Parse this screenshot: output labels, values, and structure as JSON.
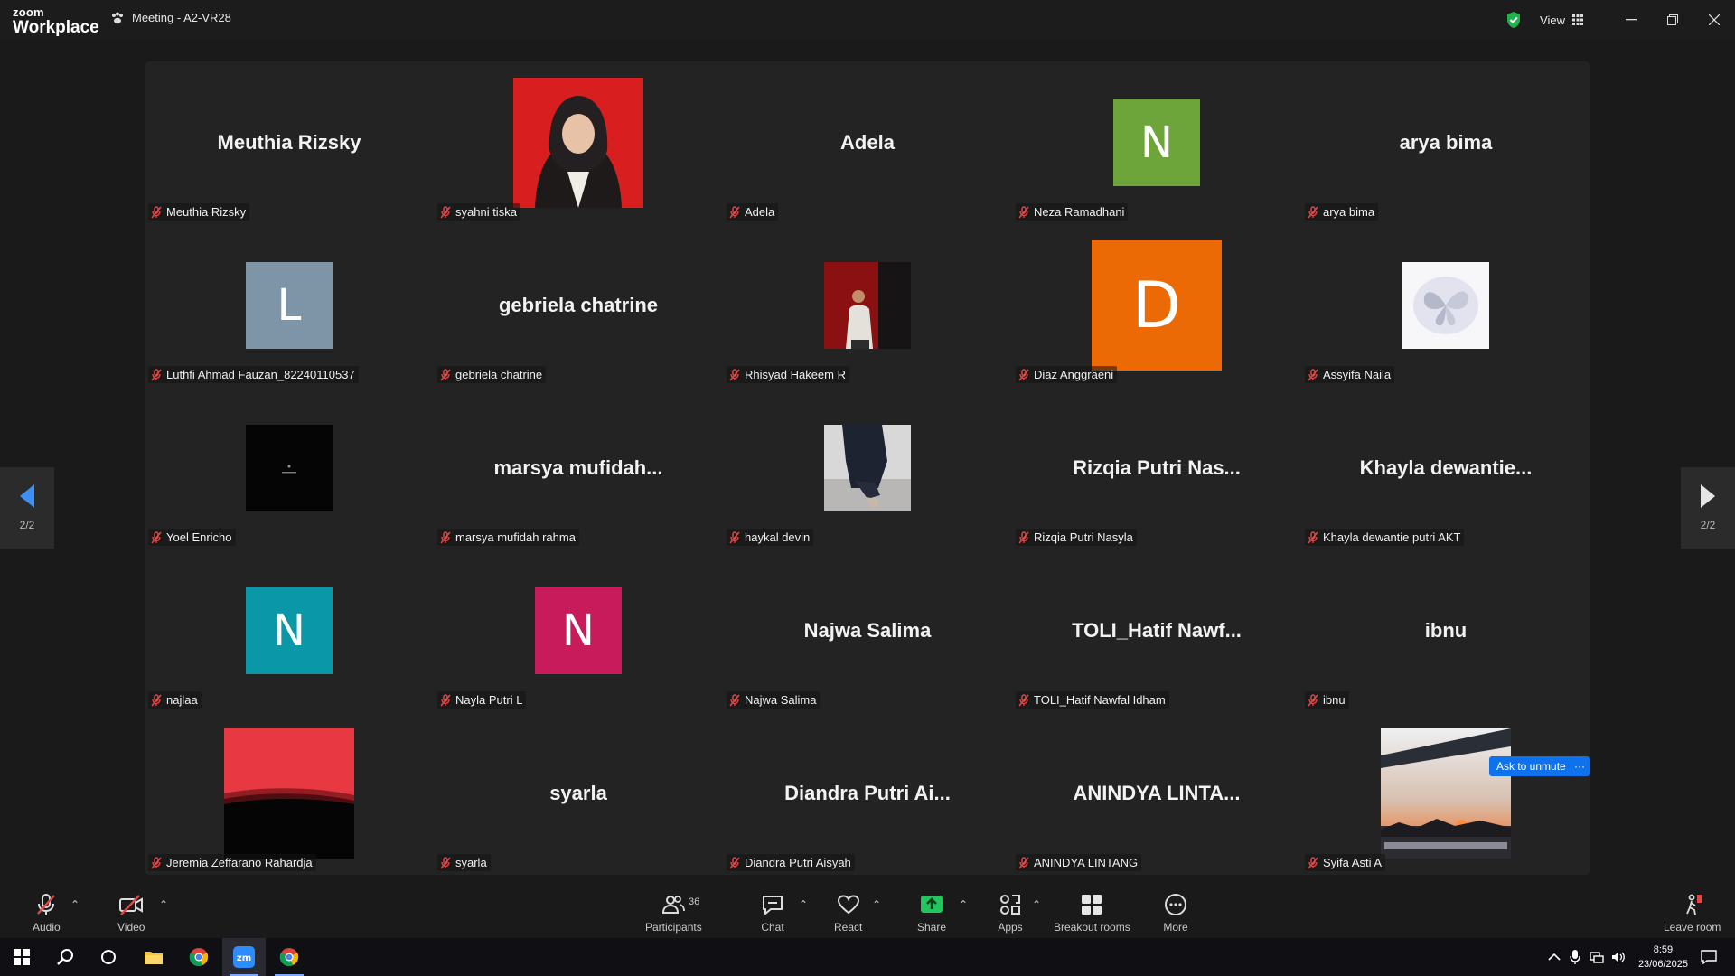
{
  "window": {
    "logo_line1": "zoom",
    "logo_line2": "Workplace",
    "meeting_title": "Meeting - A2-VR28",
    "view_label": "View"
  },
  "pager": {
    "left_label": "2/2",
    "right_label": "2/2"
  },
  "tiles": [
    {
      "name": "Meuthia Rizsky",
      "display": "Meuthia Rizsky",
      "kind": "name"
    },
    {
      "name": "syahni tiska",
      "display": "",
      "kind": "photo",
      "icon": "hijab-portrait"
    },
    {
      "name": "Adela",
      "display": "Adela",
      "kind": "name"
    },
    {
      "name": "Neza Ramadhani",
      "display": "N",
      "kind": "initial",
      "color": "#6ea53b"
    },
    {
      "name": "arya bima",
      "display": "arya bima",
      "kind": "name"
    },
    {
      "name": "Luthfi Ahmad Fauzan_82240110537",
      "display": "L",
      "kind": "initial",
      "color": "#7d95a6"
    },
    {
      "name": "gebriela chatrine",
      "display": "gebriela chatrine",
      "kind": "name"
    },
    {
      "name": "Rhisyad Hakeem R",
      "display": "",
      "kind": "photo",
      "icon": "red-room-photo"
    },
    {
      "name": "Diaz Anggraeni",
      "display": "D",
      "kind": "initial",
      "color": "#ec6a05"
    },
    {
      "name": "Assyifa Naila",
      "display": "",
      "kind": "photo",
      "icon": "butterfly-image"
    },
    {
      "name": "Yoel Enricho",
      "display": "",
      "kind": "photo",
      "icon": "dark-logo"
    },
    {
      "name": "marsya mufidah rahma",
      "display": "marsya  mufidah...",
      "kind": "name"
    },
    {
      "name": "haykal devin",
      "display": "",
      "kind": "photo",
      "icon": "person-sitting-photo"
    },
    {
      "name": "Rizqia Putri Nasyla",
      "display": "Rizqia Putri Nas...",
      "kind": "name"
    },
    {
      "name": "Khayla dewantie putri AKT",
      "display": "Khayla  dewantie...",
      "kind": "name"
    },
    {
      "name": "najlaa",
      "display": "N",
      "kind": "initial",
      "color": "#0a97a8"
    },
    {
      "name": "Nayla Putri L",
      "display": "N",
      "kind": "initial",
      "color": "#c81b5b"
    },
    {
      "name": "Najwa Salima",
      "display": "Najwa Salima",
      "kind": "name"
    },
    {
      "name": "TOLI_Hatif Nawfal Idham",
      "display": "TOLI_Hatif  Nawf...",
      "kind": "name"
    },
    {
      "name": "ibnu",
      "display": "ibnu",
      "kind": "name"
    },
    {
      "name": "Jeremia Zeffarano Rahardja",
      "display": "",
      "kind": "photo",
      "icon": "red-gradient-image"
    },
    {
      "name": "syarla",
      "display": "syarla",
      "kind": "name"
    },
    {
      "name": "Diandra Putri Aisyah",
      "display": "Diandra Putri Ai...",
      "kind": "name"
    },
    {
      "name": "ANINDYA LINTANG",
      "display": "ANINDYA  LINTA...",
      "kind": "name"
    },
    {
      "name": "Syifa Asti A",
      "display": "",
      "kind": "photo",
      "icon": "sunset-photo"
    }
  ],
  "ask_to_unmute": "Ask to unmute",
  "more_dots": "···",
  "toolbar": {
    "audio": "Audio",
    "video": "Video",
    "participants": "Participants",
    "participants_count": "36",
    "chat": "Chat",
    "react": "React",
    "share": "Share",
    "apps": "Apps",
    "breakout": "Breakout rooms",
    "more": "More",
    "leave": "Leave room"
  },
  "taskbar": {
    "time": "8:59",
    "date": "23/06/2025"
  },
  "colors": {
    "share_green": "#22c55e",
    "mute_red": "#e04848",
    "accent_blue": "#0e72ed",
    "shield_green": "#22b14c"
  }
}
